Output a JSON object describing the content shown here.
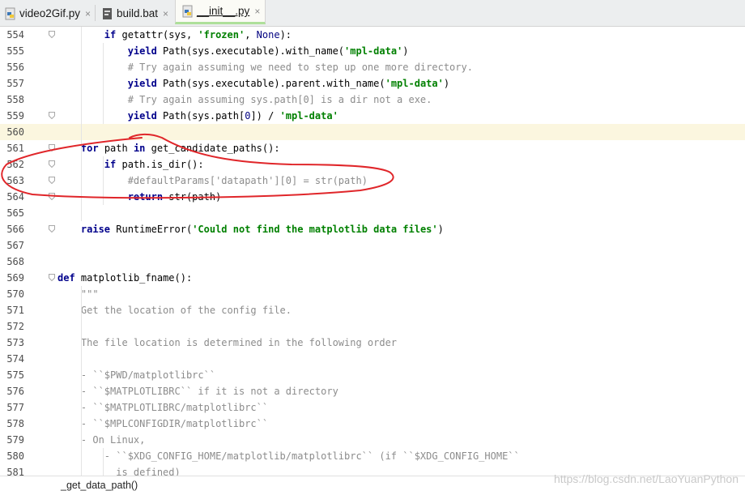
{
  "tabs": [
    {
      "label": "video2Gif.py",
      "close": "×",
      "icon": "python-file-icon",
      "active": false
    },
    {
      "label": "build.bat",
      "close": "×",
      "icon": "batch-file-icon",
      "active": false
    },
    {
      "label": "__init__.py",
      "close": "×",
      "icon": "python-file-icon",
      "active": true
    }
  ],
  "lines": [
    {
      "n": "554",
      "html": "        <span class=\"kw\">if</span> getattr(sys, <span class=\"st\">'frozen'</span>, <span class=\"bi\">None</span>):"
    },
    {
      "n": "555",
      "html": "            <span class=\"kw\">yield</span> Path(sys.executable).with_name(<span class=\"st\">'mpl-data'</span>)"
    },
    {
      "n": "556",
      "html": "            <span class=\"cm\"># Try again assuming we need to step up one more directory.</span>"
    },
    {
      "n": "557",
      "html": "            <span class=\"kw\">yield</span> Path(sys.executable).parent.with_name(<span class=\"st\">'mpl-data'</span>)"
    },
    {
      "n": "558",
      "html": "            <span class=\"cm\"># Try again assuming sys.path[0] is a dir not a exe.</span>"
    },
    {
      "n": "559",
      "html": "            <span class=\"kw\">yield</span> Path(sys.path[<span class=\"bi\">0</span>]) / <span class=\"st\">'mpl-data'</span>"
    },
    {
      "n": "560",
      "html": ""
    },
    {
      "n": "561",
      "html": "    <span class=\"kw\">for</span> path <span class=\"kw\">in</span> get_candidate_paths():"
    },
    {
      "n": "562",
      "html": "        <span class=\"kw\">if</span> path.is_dir():"
    },
    {
      "n": "563",
      "html": "            <span class=\"cm\">#defaultParams['datapath'][0] = str(path)</span>"
    },
    {
      "n": "564",
      "html": "            <span class=\"kw\">return</span> str(path)"
    },
    {
      "n": "565",
      "html": ""
    },
    {
      "n": "566",
      "html": "    <span class=\"kw\">raise</span> RuntimeError(<span class=\"st\">'Could not find the matplotlib data files'</span>)"
    },
    {
      "n": "567",
      "html": ""
    },
    {
      "n": "568",
      "html": ""
    },
    {
      "n": "569",
      "html": "<span class=\"kw\">def</span> <span class=\"fn\">matplotlib_fname</span>():"
    },
    {
      "n": "570",
      "html": "    <span class=\"doc\">\"\"\"</span>"
    },
    {
      "n": "571",
      "html": "    <span class=\"doc\">Get the location of the config file.</span>"
    },
    {
      "n": "572",
      "html": ""
    },
    {
      "n": "573",
      "html": "    <span class=\"doc\">The file location is determined in the following order</span>"
    },
    {
      "n": "574",
      "html": ""
    },
    {
      "n": "575",
      "html": "    <span class=\"doc\">- ``$PWD/matplotlibrc``</span>"
    },
    {
      "n": "576",
      "html": "    <span class=\"doc\">- ``$MATPLOTLIBRC`` if it is not a directory</span>"
    },
    {
      "n": "577",
      "html": "    <span class=\"doc\">- ``$MATPLOTLIBRC/matplotlibrc``</span>"
    },
    {
      "n": "578",
      "html": "    <span class=\"doc\">- ``$MPLCONFIGDIR/matplotlibrc``</span>"
    },
    {
      "n": "579",
      "html": "    <span class=\"doc\">- On Linux,</span>"
    },
    {
      "n": "580",
      "html": "        <span class=\"doc\">- ``$XDG_CONFIG_HOME/matplotlib/matplotlibrc`` (if ``$XDG_CONFIG_HOME``</span>"
    },
    {
      "n": "581",
      "html": "          <span class=\"doc\">is defined)</span>"
    }
  ],
  "highlight_line": "560",
  "breadcrumb": "_get_data_path()",
  "watermark": "https://blog.csdn.net/LaoYuanPython",
  "colors": {
    "annotation": "#e0262a",
    "current_line": "#fbf6df",
    "active_tab_underline": "#aee09a"
  }
}
